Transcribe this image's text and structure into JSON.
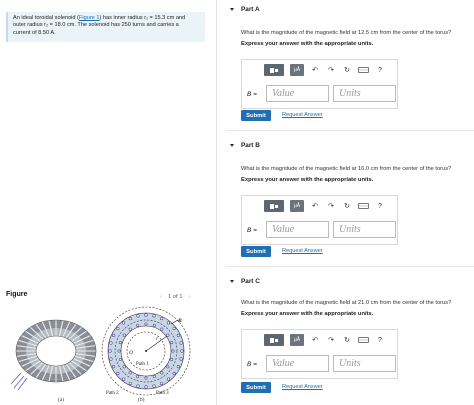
{
  "problem": {
    "line1_pre": "An ideal toroidal solenoid (",
    "link": "Figure 1",
    "line1_post": ") has inner radius r₁ = 15.3 cm and",
    "line2": "outer radius r₂ = 18.0 cm. The solenoid has 250 turns and carries a",
    "line3": "current of 8.50 A."
  },
  "figure": {
    "label": "Figure",
    "pager": {
      "prev": "‹",
      "position": "1 of 1",
      "next": "›"
    },
    "labels": {
      "a": "(a)",
      "b": "(b)",
      "path1": "Path 1",
      "path2": "Path 2",
      "path3": "Path 3",
      "O": "O",
      "r": "r",
      "B": "B"
    }
  },
  "toolbar_icons": [
    "template-icon",
    "mu-a-icon",
    "undo-icon",
    "redo-icon",
    "reset-icon",
    "keyboard-icon",
    "help-icon"
  ],
  "toolbar": {
    "mu": "μÅ",
    "undo": "↶",
    "redo": "↷",
    "reset": "↻",
    "kbd": "▭▭▭",
    "help": "?"
  },
  "parts": [
    {
      "title": "Part A",
      "question": "What is the magnitude of the magnetic field at 12.5 cm from the center of the torus?",
      "instruction": "Express your answer with the appropriate units.",
      "symbol": "B =",
      "value_placeholder": "Value",
      "units_placeholder": "Units",
      "submit": "Submit",
      "request": "Request Answer"
    },
    {
      "title": "Part B",
      "question": "What is the magnitude of the magnetic field at 16.0 cm from the center of the torus?",
      "instruction": "Express your answer with the appropriate units.",
      "symbol": "B =",
      "value_placeholder": "Value",
      "units_placeholder": "Units",
      "submit": "Submit",
      "request": "Request Answer"
    },
    {
      "title": "Part C",
      "question": "What is the magnitude of the magnetic field at 21.0 cm from the center of the torus?",
      "instruction": "Express your answer with the appropriate units.",
      "symbol": "B =",
      "value_placeholder": "Value",
      "units_placeholder": "Units",
      "submit": "Submit",
      "request": "Request Answer"
    }
  ],
  "colors": {
    "accent": "#1f6fb2",
    "link": "#1a6fb5",
    "problem_bg": "#eaf3f8"
  }
}
